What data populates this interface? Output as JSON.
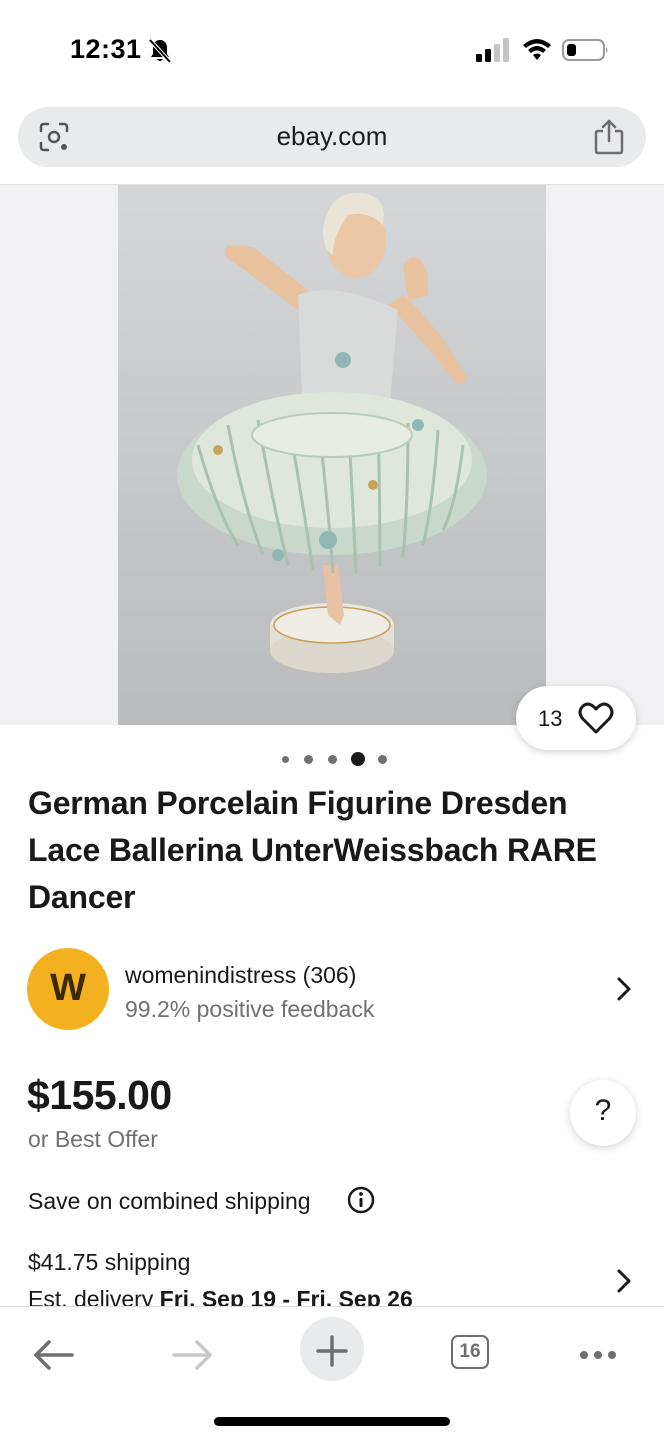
{
  "status_bar": {
    "time": "12:31",
    "icons": [
      "bell-slash-icon",
      "signal-icon",
      "wifi-icon",
      "battery-icon"
    ]
  },
  "browser": {
    "url": "ebay.com",
    "icons": [
      "lens-icon",
      "share-icon"
    ]
  },
  "listing": {
    "image_alt": "German Porcelain Figurine Dresden Lace Ballerina",
    "watch_count": "13",
    "carousel": {
      "total": 5,
      "active_index": 3
    },
    "title": "German Porcelain Figurine Dresden Lace Ballerina UnterWeissbach RARE Dancer",
    "seller": {
      "avatar_letter": "W",
      "name_with_score": "womenindistress (306)",
      "feedback": "99.2% positive feedback"
    },
    "price": "$155.00",
    "best_offer": "or Best Offer",
    "help_glyph": "?",
    "combined_shipping": "Save on combined shipping",
    "shipping": "$41.75 shipping",
    "delivery_prefix": "Est. delivery ",
    "delivery_range": "Fri, Sep 19 - Fri, Sep 26"
  },
  "toolbar": {
    "tabs_count": "16",
    "icons": [
      "back-arrow-icon",
      "forward-arrow-icon",
      "plus-icon",
      "tabs-icon",
      "more-icon"
    ]
  },
  "colors": {
    "accent_avatar": "#f3b120",
    "text_primary": "#191919",
    "text_secondary": "#707070",
    "url_bar_bg": "#e9eaec"
  }
}
